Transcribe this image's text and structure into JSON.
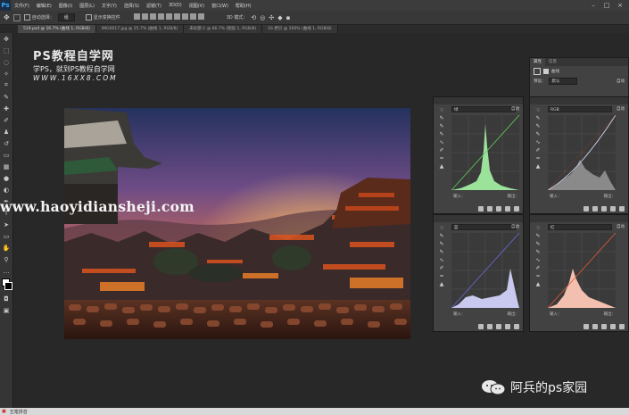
{
  "app": {
    "logo": "Ps"
  },
  "menu": [
    "文件(F)",
    "编辑(E)",
    "图像(I)",
    "图层(L)",
    "文字(Y)",
    "选择(S)",
    "滤镜(T)",
    "3D(D)",
    "视图(V)",
    "窗口(W)",
    "帮助(H)"
  ],
  "window_controls": [
    "–",
    "□",
    "×"
  ],
  "options": {
    "auto_select_label": "自动选择：",
    "auto_select_value": "组",
    "show_transform_label": "显示变换控件",
    "mode_3d_label": "3D 模式："
  },
  "tabs": [
    {
      "label": "519.psd @ 16.7% (曲线 1, RGB/8)",
      "active": true
    },
    {
      "label": "IMG0017.jpg @ 25.7% (曲线 1, RGB/8)",
      "active": false
    },
    {
      "label": "未标题-1 @ 66.7% (图层 1, RGB/8)",
      "active": false
    },
    {
      "label": "16 拷贝 @ 100% (曲线 1, RGB/8)",
      "active": false
    }
  ],
  "tools": [
    "move-icon",
    "marquee-icon",
    "lasso-icon",
    "wand-icon",
    "crop-icon",
    "eyedropper-icon",
    "heal-icon",
    "brush-icon",
    "stamp-icon",
    "history-brush-icon",
    "eraser-icon",
    "gradient-icon",
    "blur-icon",
    "dodge-icon",
    "pen-icon",
    "type-icon",
    "path-select-icon",
    "shape-icon",
    "hand-icon",
    "zoom-icon"
  ],
  "watermark_top": {
    "title": "PS教程自学网",
    "subtitle": "学PS，就到PS教程自学网",
    "url": "WWW.16XX8.COM"
  },
  "watermark_mid": "www.haoyidiansheji.com",
  "watermark_br": "阿兵的ps家园",
  "properties": {
    "tabs": [
      "属性",
      "信息"
    ],
    "title": "曲线",
    "preset_label": "预设：",
    "preset_value": "默认"
  },
  "curves": [
    {
      "channel": "绿",
      "auto": "自动",
      "input": "输入：",
      "output": "输出："
    },
    {
      "channel": "RGB",
      "auto": "自动",
      "input": "输入：",
      "output": "输出："
    },
    {
      "channel": "蓝",
      "auto": "自动",
      "input": "输入：",
      "output": "输出："
    },
    {
      "channel": "红",
      "auto": "自动",
      "input": "输入：",
      "output": "输出："
    }
  ],
  "taskbar": {
    "ime": "五笔拼音"
  },
  "colors": {
    "green_hist": "#9be39b",
    "gray_hist": "#8a8a8a",
    "blue_hist": "#c9c9ef",
    "red_hist": "#f3c0b0",
    "ui_bg": "#282828"
  }
}
